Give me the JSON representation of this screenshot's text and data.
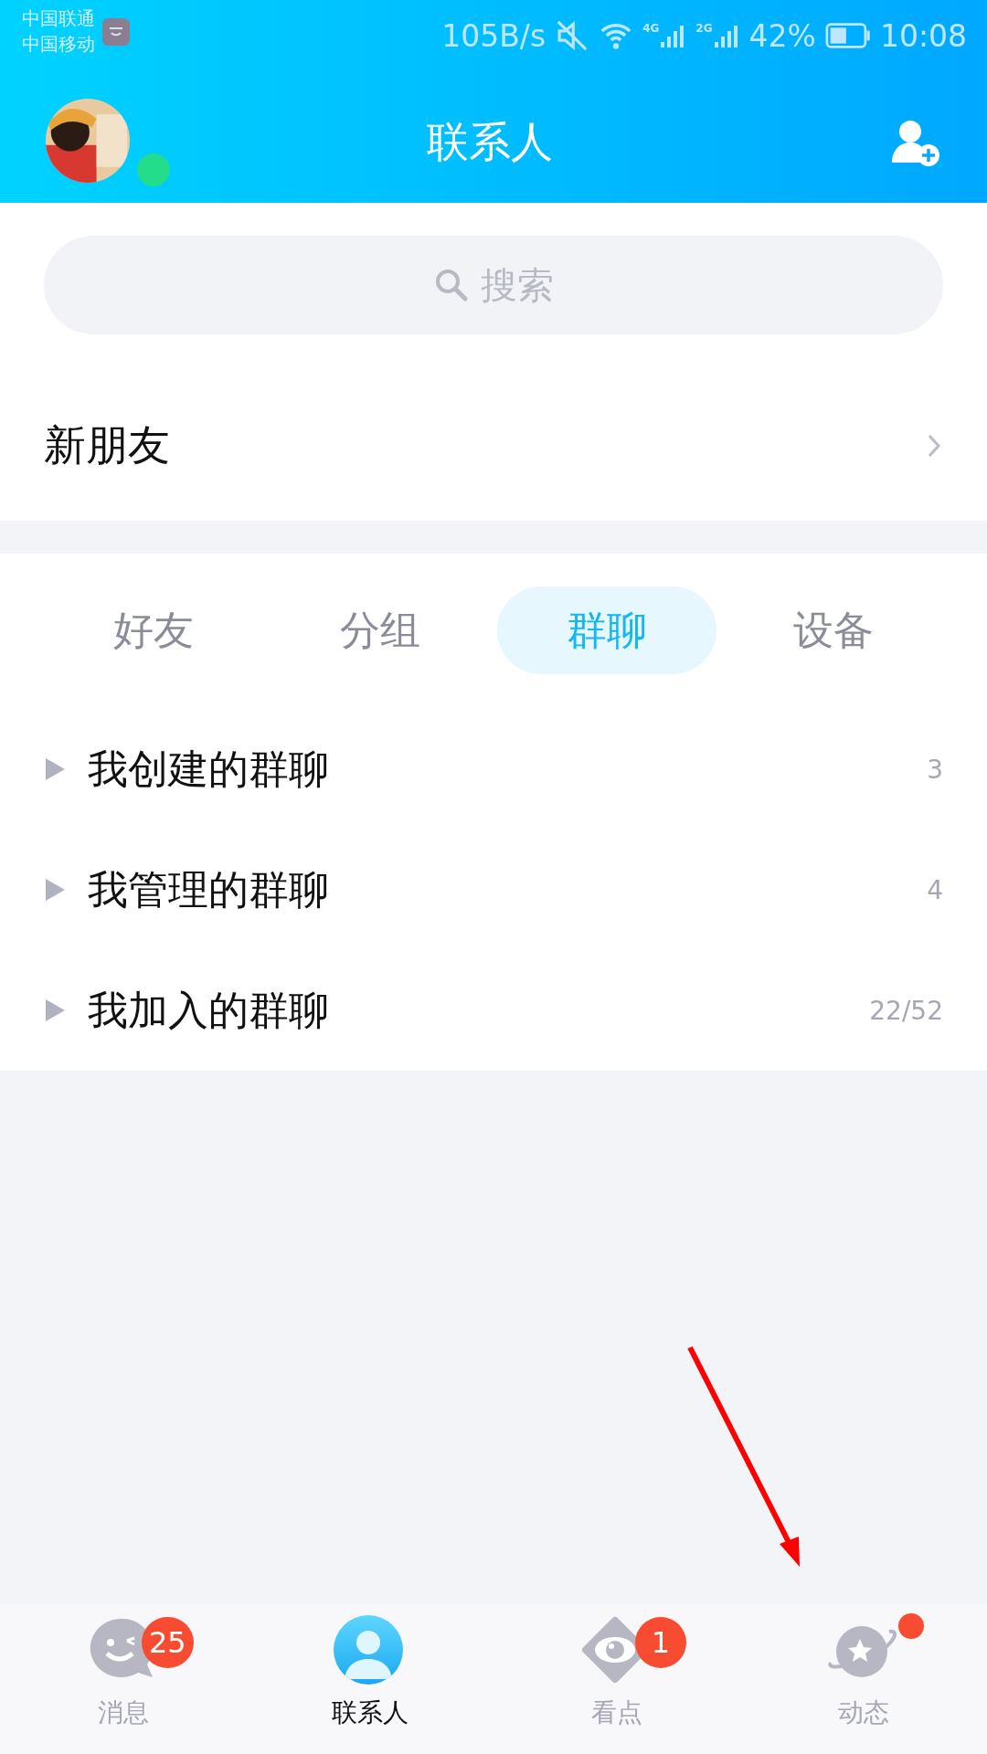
{
  "status_bar": {
    "carriers": [
      "中国联通",
      "中国移动"
    ],
    "speed": "105B/s",
    "networks": [
      "4G",
      "2G"
    ],
    "battery": "42%",
    "time": "10:08"
  },
  "header": {
    "title": "联系人",
    "online": true
  },
  "search": {
    "placeholder": "搜索"
  },
  "new_friends": {
    "label": "新朋友"
  },
  "tabs": [
    {
      "label": "好友",
      "selected": false
    },
    {
      "label": "分组",
      "selected": false
    },
    {
      "label": "群聊",
      "selected": true
    },
    {
      "label": "设备",
      "selected": false
    }
  ],
  "groups": [
    {
      "name": "我创建的群聊",
      "count": "3",
      "expanded": false
    },
    {
      "name": "我管理的群聊",
      "count": "4",
      "expanded": false
    },
    {
      "name": "我加入的群聊",
      "count": "22/52",
      "expanded": false
    }
  ],
  "bottom_nav": [
    {
      "kind": "chat",
      "label": "消息",
      "badge": "25",
      "selected": false
    },
    {
      "kind": "contacts",
      "label": "联系人",
      "selected": true
    },
    {
      "kind": "eye",
      "label": "看点",
      "badge": "1",
      "selected": false
    },
    {
      "kind": "planet",
      "label": "动态",
      "dot": true,
      "selected": false
    }
  ],
  "annotation": {
    "kind": "arrow"
  }
}
